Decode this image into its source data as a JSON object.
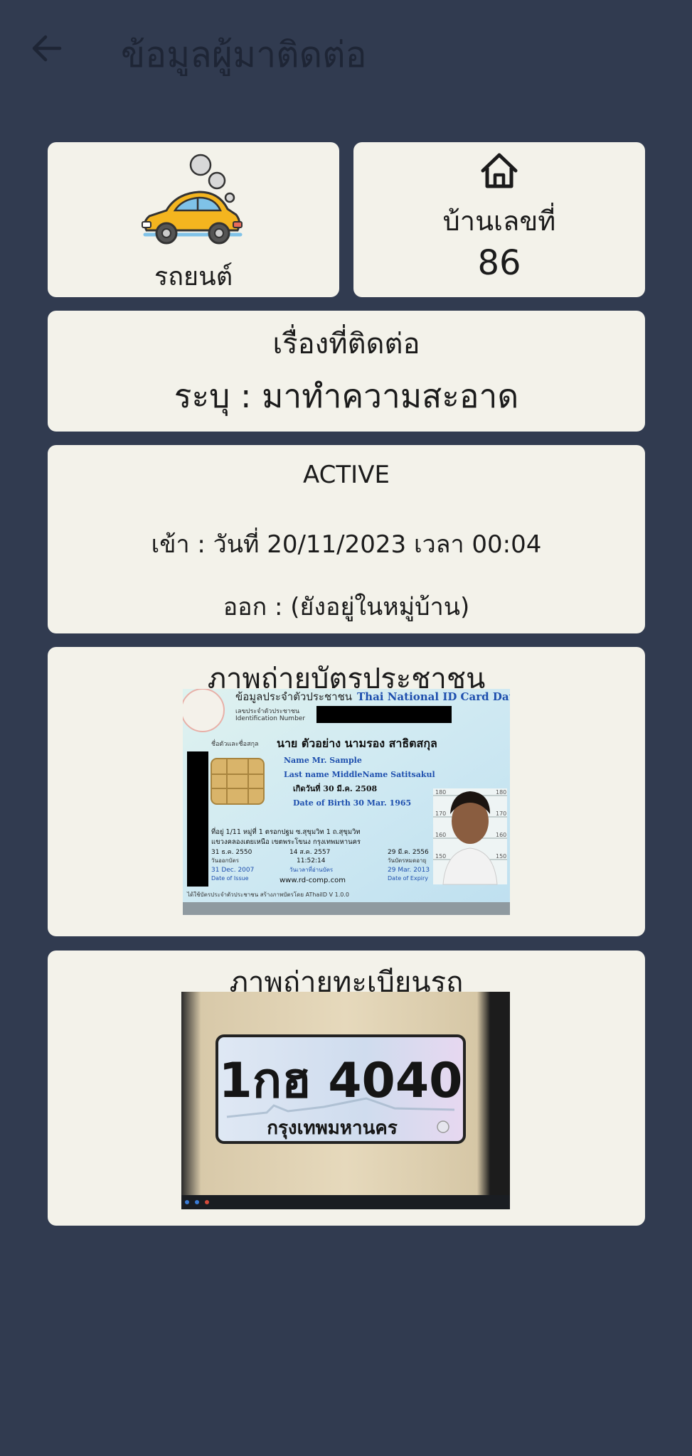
{
  "header": {
    "title": "ข้อมูลผู้มาติดต่อ",
    "back_icon": "arrow-left-icon"
  },
  "vehicle": {
    "label": "รถยนต์",
    "icon": "car-icon"
  },
  "house": {
    "label": "บ้านเลขที่",
    "number": "86",
    "icon": "home-icon"
  },
  "contact": {
    "heading": "เรื่องที่ติดต่อ",
    "detail": "ระบุ : มาทำความสะอาด"
  },
  "status": {
    "state": "ACTIVE",
    "entry": "เข้า : วันที่ 20/11/2023 เวลา 00:04",
    "exit": "ออก : (ยังอยู่ในหมู่บ้าน)"
  },
  "id_card_photo": {
    "title": "ภาพถ่ายบัตรประชาชน",
    "card": {
      "header_th": "ข้อมูลประจำตัวประชาชน",
      "header_en": "Thai National ID Card Data",
      "id_label_th": "เลขประจำตัวประชาชน",
      "id_label_en": "Identification Number",
      "name_label": "ชื่อตัวและชื่อสกุล",
      "name_th": "นาย ตัวอย่าง นามรอง สาธิตสกุล",
      "name_en": "Name  Mr. Sample",
      "lastname_en": "Last name  MiddleName Satitsakul",
      "dob_th": "เกิดวันที่  30 มี.ค. 2508",
      "dob_en": "Date of Birth  30 Mar. 1965",
      "address": "ที่อยู่   1/11 หมู่ที่ 1 ตรอกปฐม ซ.สุขุมวิท 1 ถ.สุขุมวิท",
      "address2": "แขวงคลองเตยเหนือ เขตพระโขนง กรุงเทพมหานคร",
      "issue_th": "31 ธ.ค. 2550",
      "issue_label_th": "วันออกบัตร",
      "issue_en": "31 Dec. 2007",
      "issue_label_en": "Date of Issue",
      "print_date": "14 ส.ค. 2557",
      "print_time": "11:52:14",
      "print_label": "วันเวลาที่อ่านบัตร",
      "website": "www.rd-comp.com",
      "expiry_th": "29 มี.ค. 2556",
      "expiry_label_th": "วันบัตรหมดอายุ",
      "expiry_en": "29 Mar. 2013",
      "expiry_label_en": "Date of Expiry",
      "footer": "ได้ใช้บัตรประจำตัวประชาชน สร้างภาพบัตรโดย AThaiID V 1.0.0",
      "height_marks": [
        "180",
        "170",
        "160",
        "150"
      ]
    }
  },
  "plate_photo": {
    "title": "ภาพถ่ายทะเบียนรถ",
    "plate_number": "1กฮ 4040",
    "plate_province": "กรุงเทพมหานคร"
  }
}
